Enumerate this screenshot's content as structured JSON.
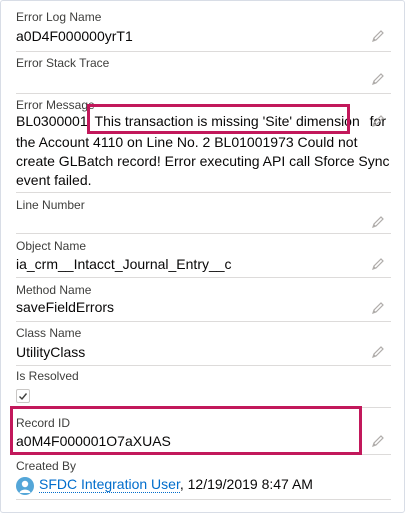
{
  "fields": {
    "error_log_name": {
      "label": "Error Log Name",
      "value": "a0D4F000000yrT1"
    },
    "error_stack_trace": {
      "label": "Error Stack Trace",
      "value": ""
    },
    "error_message": {
      "label": "Error Message",
      "prefix": "BL0300001",
      "highlighted": "This transaction is missing 'Site' dimension",
      "suffix_after_highlight": "for",
      "rest_line1": "the Account 4110 on Line No. 2 BL01001973 Could not",
      "rest_line2": "create GLBatch record! Error executing API call Sforce Sync",
      "rest_line3": "event failed."
    },
    "line_number": {
      "label": "Line Number",
      "value": ""
    },
    "object_name": {
      "label": "Object Name",
      "value": "ia_crm__Intacct_Journal_Entry__c"
    },
    "method_name": {
      "label": "Method Name",
      "value": "saveFieldErrors"
    },
    "class_name": {
      "label": "Class Name",
      "value": "UtilityClass"
    },
    "is_resolved": {
      "label": "Is Resolved",
      "checked": true
    },
    "record_id": {
      "label": "Record ID",
      "value": "a0M4F000001O7aXUAS"
    },
    "created_by": {
      "label": "Created By",
      "user": "SFDC Integration User",
      "separator": ",",
      "datetime": "12/19/2019 8:47 AM"
    }
  },
  "colors": {
    "highlight": "#c2185b",
    "link": "#006dcc",
    "avatar": "#54a6d8"
  },
  "icons": {
    "edit": "pencil-icon",
    "avatar": "user-avatar-icon",
    "check": "checkmark-icon"
  }
}
